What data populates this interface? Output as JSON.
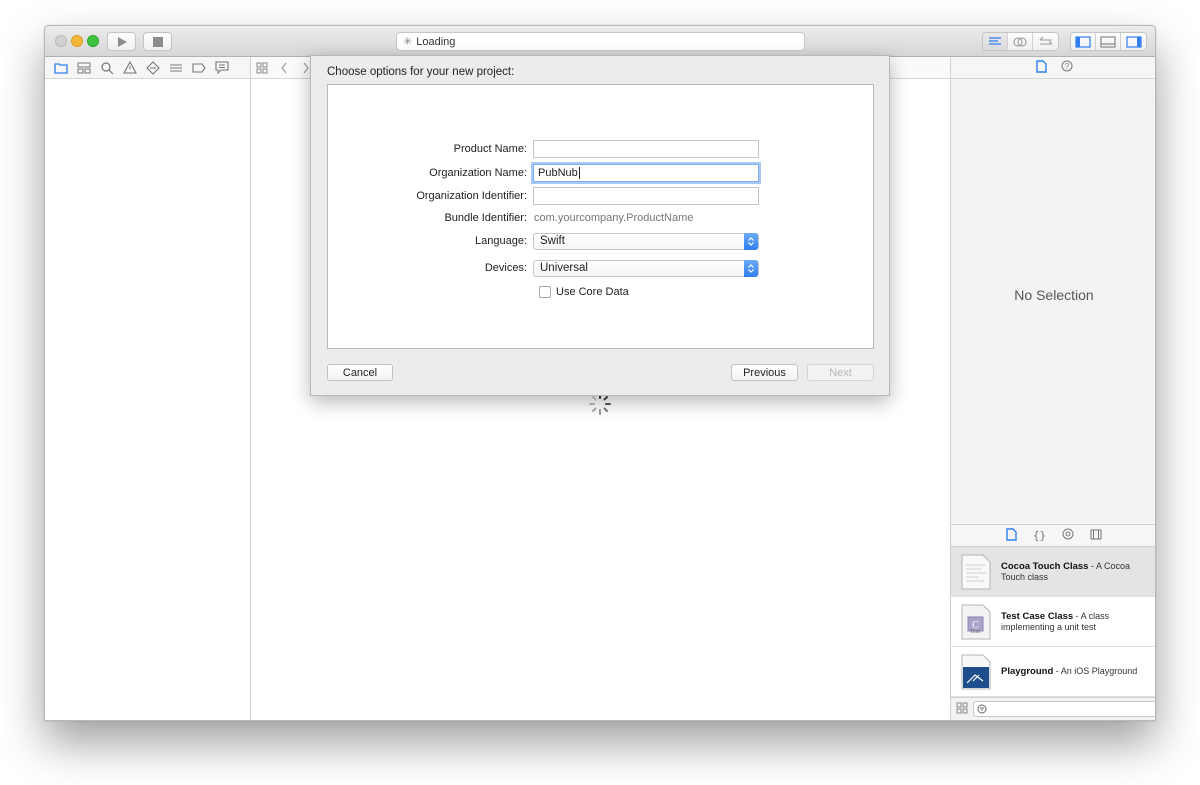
{
  "toolbar": {
    "activity_text": "Loading"
  },
  "inspector": {
    "no_selection": "No Selection"
  },
  "library": {
    "items": [
      {
        "title": "Cocoa Touch Class",
        "description": " - A Cocoa Touch class",
        "thumb_label": ""
      },
      {
        "title": "Test Case Class",
        "description": " - A class implementing a unit test",
        "thumb_label": "Test"
      },
      {
        "title": "Playground",
        "description": " - An iOS Playground",
        "thumb_label": ""
      }
    ],
    "filter_placeholder": ""
  },
  "sheet": {
    "title": "Choose options for your new project:",
    "fields": {
      "product_name": {
        "label": "Product Name:",
        "value": ""
      },
      "organization_name": {
        "label": "Organization Name:",
        "value": "PubNub"
      },
      "organization_identifier": {
        "label": "Organization Identifier:",
        "value": ""
      },
      "bundle_identifier": {
        "label": "Bundle Identifier:",
        "value": "com.yourcompany.ProductName"
      },
      "language": {
        "label": "Language:",
        "value": "Swift"
      },
      "devices": {
        "label": "Devices:",
        "value": "Universal"
      },
      "use_core_data": {
        "label": "Use Core Data",
        "checked": false
      }
    },
    "buttons": {
      "cancel": "Cancel",
      "previous": "Previous",
      "next": "Next"
    }
  },
  "colors": {
    "accent": "#2f7ff0",
    "close": "#d0d0d0",
    "minimize": "#f4b638",
    "zoom": "#3fc43f"
  }
}
